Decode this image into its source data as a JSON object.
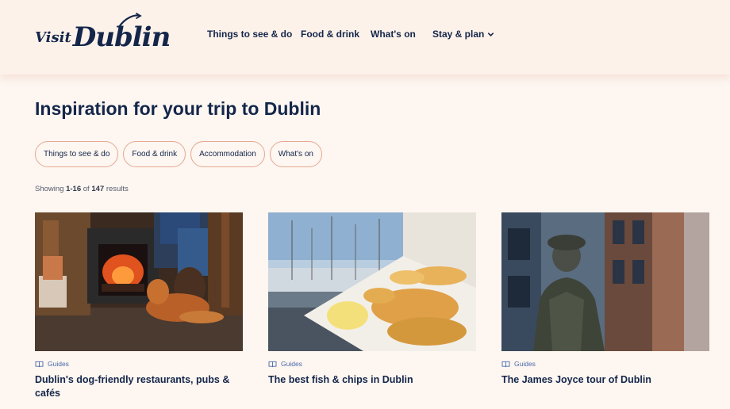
{
  "header": {
    "logo_small": "Visit",
    "logo_big": "Dublin",
    "nav": [
      {
        "label": "Things to see & do"
      },
      {
        "label": "Food & drink"
      },
      {
        "label": "What's on"
      },
      {
        "label": "Stay & plan",
        "icon": "chevron-down-icon"
      }
    ]
  },
  "main": {
    "title": "Inspiration for your trip to Dublin",
    "filters": [
      "Things to see & do",
      "Food & drink",
      "Accommodation",
      "What's on"
    ],
    "results": {
      "prefix": "Showing",
      "range": "1-16",
      "of": "of",
      "total": "147",
      "suffix": "results"
    }
  },
  "cards": [
    {
      "tag": "Guides",
      "tag_icon": "book-icon",
      "title": "Dublin's dog-friendly restaurants, pubs & cafés"
    },
    {
      "tag": "Guides",
      "tag_icon": "book-icon",
      "title": "The best fish & chips in Dublin"
    },
    {
      "tag": "Guides",
      "tag_icon": "book-icon",
      "title": "The James Joyce tour of Dublin"
    }
  ],
  "colors": {
    "page_bg": "#fdf6f1",
    "header_bg": "#fdf2ea",
    "navy": "#14264a",
    "chip_border": "#e6a890",
    "tag_blue": "#4a6aa8"
  }
}
